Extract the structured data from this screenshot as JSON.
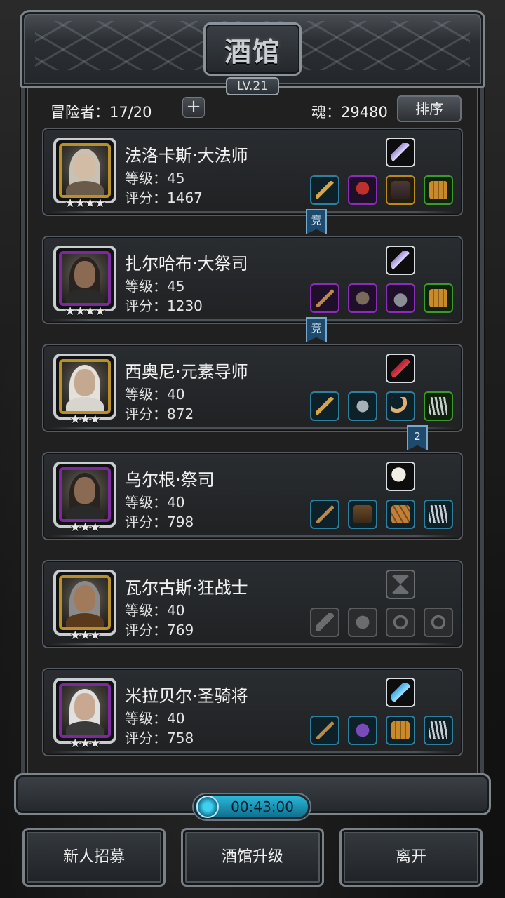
{
  "tavern": {
    "title": "酒馆",
    "level": "LV.21"
  },
  "header": {
    "adventurers": "冒险者：17/20",
    "add_symbol": "+",
    "soul": "魂：29480",
    "sort_label": "排序"
  },
  "heroes": [
    {
      "name": "法洛卡斯·大法师",
      "level": "等级：45",
      "score": "评分：1467",
      "stars": "★★★★",
      "frame": "gold",
      "skill_icon": "crystal-shard-icon",
      "gear": [
        {
          "icon": "staff-icon",
          "quality": "blue"
        },
        {
          "icon": "red-hood-icon",
          "quality": "purple"
        },
        {
          "icon": "robe-icon",
          "quality": "gold"
        },
        {
          "icon": "barrel-shield-icon",
          "quality": "green"
        }
      ],
      "ribbon": "竞"
    },
    {
      "name": "扎尔哈布·大祭司",
      "level": "等级：45",
      "score": "评分：1230",
      "stars": "★★★★",
      "frame": "purple",
      "skill_icon": "crystal-shard-icon",
      "gear": [
        {
          "icon": "hammer-icon",
          "quality": "purple"
        },
        {
          "icon": "armor-icon",
          "quality": "purple"
        },
        {
          "icon": "helmet-icon",
          "quality": "purple"
        },
        {
          "icon": "barrel-shield-icon",
          "quality": "green"
        }
      ],
      "ribbon": "竞"
    },
    {
      "name": "西奥尼·元素导师",
      "level": "等级：40",
      "score": "评分：872",
      "stars": "★★★",
      "frame": "gold",
      "skill_icon": "red-rune-icon",
      "gear": [
        {
          "icon": "staff-icon",
          "quality": "blue"
        },
        {
          "icon": "pauldron-icon",
          "quality": "blue"
        },
        {
          "icon": "horn-icon",
          "quality": "blue"
        },
        {
          "icon": "gauntlet-icon",
          "quality": "green"
        }
      ],
      "ribbon": "2"
    },
    {
      "name": "乌尔根·祭司",
      "level": "等级：40",
      "score": "评分：798",
      "stars": "★★★",
      "frame": "purple",
      "skill_icon": "white-horn-icon",
      "gear": [
        {
          "icon": "hammer-icon",
          "quality": "blue"
        },
        {
          "icon": "leather-armor-icon",
          "quality": "blue"
        },
        {
          "icon": "wooden-shield-icon",
          "quality": "blue"
        },
        {
          "icon": "gauntlet-icon",
          "quality": "blue"
        }
      ]
    },
    {
      "name": "瓦尔古斯·狂战士",
      "level": "等级：40",
      "score": "评分：769",
      "stars": "★★★",
      "frame": "gold",
      "skill_icon": "empty-slot-icon",
      "gear": [
        {
          "icon": "axe-silhouette-icon",
          "quality": "empty"
        },
        {
          "icon": "armor-silhouette-icon",
          "quality": "empty"
        },
        {
          "icon": "ring-silhouette-icon",
          "quality": "empty"
        },
        {
          "icon": "ring-silhouette-icon",
          "quality": "empty"
        }
      ]
    },
    {
      "name": "米拉贝尔·圣骑将",
      "level": "等级：40",
      "score": "评分：758",
      "stars": "★★★",
      "frame": "purple",
      "skill_icon": "blue-crystal-icon",
      "gear": [
        {
          "icon": "hammer-icon",
          "quality": "blue"
        },
        {
          "icon": "purple-armor-icon",
          "quality": "blue"
        },
        {
          "icon": "barrel-shield-icon",
          "quality": "blue"
        },
        {
          "icon": "gauntlet-icon",
          "quality": "blue"
        }
      ]
    }
  ],
  "timer": "00:43:00",
  "actions": {
    "recruit": "新人招募",
    "upgrade": "酒馆升级",
    "leave": "离开"
  },
  "colors": {
    "blue_quality": "#2f7e9c",
    "purple_quality": "#8a2eb8",
    "gold_quality": "#b88a1e",
    "green_quality": "#3a9a2a",
    "timer_accent": "#2bb6d8"
  }
}
